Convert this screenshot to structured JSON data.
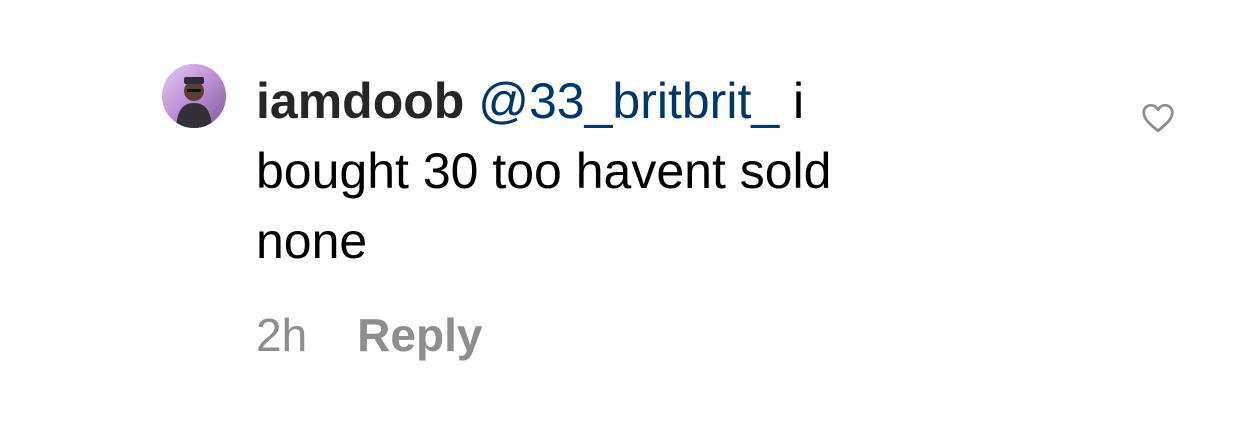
{
  "comment": {
    "username": "iamdoob",
    "mention": "@33_britbrit_",
    "text_after_mention": " i bought 30 too havent sold none",
    "time": "2h",
    "reply_label": "Reply",
    "avatar_icon": "profile-photo",
    "like_icon": "heart-outline-icon"
  },
  "colors": {
    "username": "#262626",
    "mention": "#00376b",
    "meta": "#8e8e8e",
    "heart": "#8e8e8e"
  }
}
